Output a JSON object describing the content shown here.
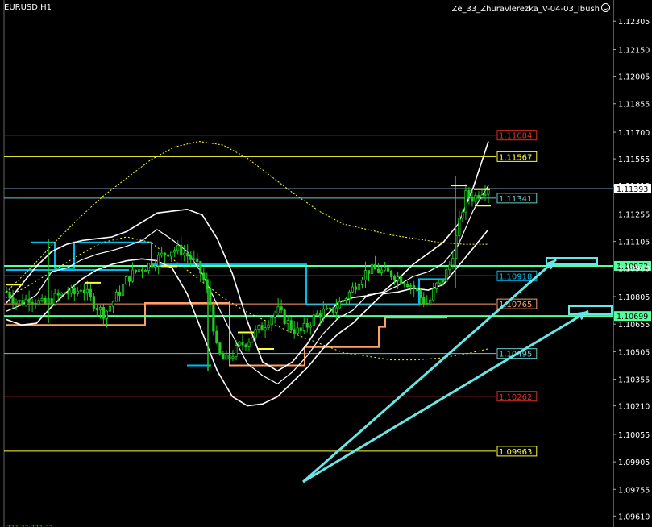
{
  "window": {
    "symbol": "EURUSD,H1",
    "indicator": "Ze_33_Zhuravlerezka_V-04-03_Ibush",
    "footer": "???-??:???-??"
  },
  "colors": {
    "background": "#000000",
    "candle": "#22cc22",
    "red_level": "#e03020",
    "yellow_level": "#ffff33",
    "cyan_level": "#66cccc",
    "aqua_step": "#00bbee",
    "orange_step": "#ffa066",
    "green_line": "#55ff99",
    "band": "#ffffff",
    "arrow": "#66e6e6"
  },
  "chart_data": {
    "type": "candlestick",
    "symbol": "EURUSD",
    "timeframe": "H1",
    "ylim": [
      1.0955,
      1.1242
    ],
    "y_ticks": [
      "1.12305",
      "1.12150",
      "1.12005",
      "1.11855",
      "1.11700",
      "1.11555",
      "1.11410",
      "1.11255",
      "1.11105",
      "1.10960",
      "1.10805",
      "1.10655",
      "1.10505",
      "1.10355",
      "1.10210",
      "1.10055",
      "1.09905",
      "1.09755",
      "1.09610"
    ],
    "current_price": "1.11393",
    "levels": [
      {
        "label": "1.11684",
        "price": 1.11684,
        "type": "red"
      },
      {
        "label": "1.11567",
        "price": 1.11567,
        "type": "yellow"
      },
      {
        "label": "1.11341",
        "price": 1.11341,
        "type": "cyan"
      },
      {
        "label": "1.10918",
        "price": 1.10918,
        "type": "aqua"
      },
      {
        "label": "1.10765",
        "price": 1.10765,
        "type": "orange"
      },
      {
        "label": "1.10495",
        "price": 1.10495,
        "type": "cyan"
      },
      {
        "label": "1.10262",
        "price": 1.10262,
        "type": "red"
      },
      {
        "label": "1.09963",
        "price": 1.09963,
        "type": "yellow"
      }
    ],
    "axis_marks": [
      {
        "label": "1.10972",
        "price": 1.10972
      },
      {
        "label": "1.10699",
        "price": 1.10699
      }
    ],
    "close_path": [
      1.1083,
      1.1079,
      1.1077,
      1.108,
      1.1078,
      1.1076,
      1.1079,
      1.1081,
      1.1083,
      1.1082,
      1.1086,
      1.108,
      1.1075,
      1.1071,
      1.1077,
      1.1083,
      1.109,
      1.1094,
      1.1096,
      1.1098,
      1.1101,
      1.1104,
      1.1106,
      1.1106,
      1.1103,
      1.1099,
      1.1092,
      1.1078,
      1.105,
      1.1045,
      1.1049,
      1.1054,
      1.1056,
      1.1061,
      1.1064,
      1.1069,
      1.1073,
      1.1068,
      1.1063,
      1.1061,
      1.1065,
      1.107,
      1.1072,
      1.1072,
      1.1076,
      1.108,
      1.1085,
      1.1091,
      1.1095,
      1.1095,
      1.1094,
      1.1093,
      1.1091,
      1.1089,
      1.1086,
      1.108,
      1.1076,
      1.1086,
      1.109,
      1.1099,
      1.1118,
      1.1136,
      1.1134,
      1.1138,
      1.114
    ],
    "upper_band": [
      1.1077,
      1.1087,
      1.1097,
      1.1105,
      1.1109,
      1.1111,
      1.1112,
      1.1113,
      1.1116,
      1.1121,
      1.1126,
      1.1127,
      1.1128,
      1.1125,
      1.1112,
      1.1093,
      1.1067,
      1.1045,
      1.104,
      1.1045,
      1.1055,
      1.1068,
      1.1077,
      1.108,
      1.1081,
      1.1083,
      1.109,
      1.1098,
      1.1104,
      1.111,
      1.112,
      1.114,
      1.1165
    ],
    "lower_band": [
      1.1068,
      1.1065,
      1.1066,
      1.1075,
      1.1083,
      1.109,
      1.1095,
      1.1098,
      1.11,
      1.1101,
      1.11,
      1.1096,
      1.1082,
      1.1061,
      1.104,
      1.1026,
      1.1021,
      1.1022,
      1.1026,
      1.1034,
      1.1042,
      1.1052,
      1.106,
      1.1066,
      1.1074,
      1.1082,
      1.1083,
      1.1085,
      1.1084,
      1.1087,
      1.1097,
      1.1107,
      1.1117
    ],
    "dotted_upper": [
      1.1083,
      1.1096,
      1.111,
      1.1123,
      1.1135,
      1.1145,
      1.1155,
      1.1162,
      1.1165,
      1.1163,
      1.1156,
      1.1146,
      1.1136,
      1.1127,
      1.112,
      1.1117,
      1.1114,
      1.1112,
      1.111,
      1.1109,
      1.1109
    ]
  }
}
